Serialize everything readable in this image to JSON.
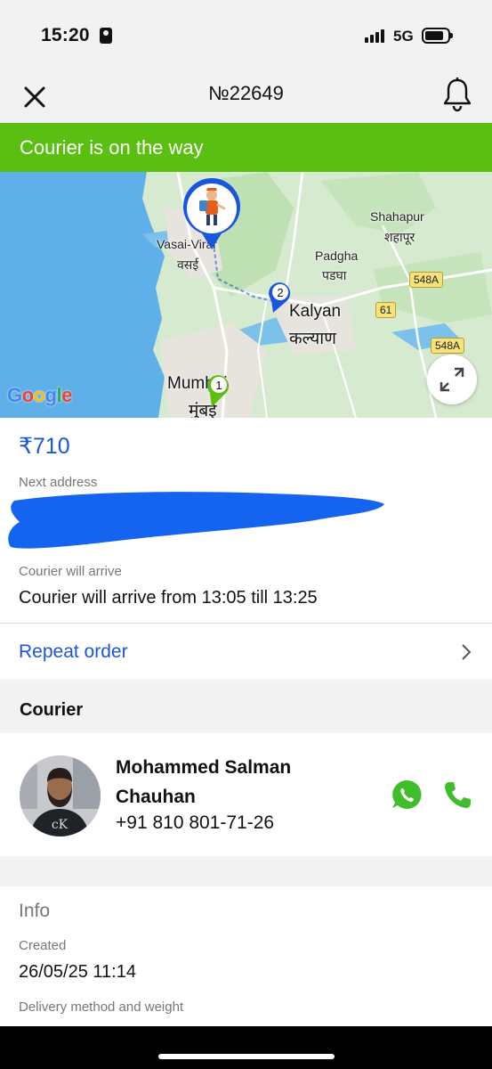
{
  "status_bar": {
    "time": "15:20",
    "network": "5G"
  },
  "header": {
    "order_number": "№22649",
    "close_icon": "close-icon",
    "bell_icon": "bell-icon"
  },
  "status_banner": {
    "text": "Courier is on the way",
    "color": "#5bbf12"
  },
  "map": {
    "labels": {
      "vasai_en": "Vasai-Virar",
      "vasai_local": "वसई",
      "shahapur_en": "Shahapur",
      "shahapur_local": "शहापूर",
      "padgha_en": "Padgha",
      "padgha_local": "पडघा",
      "kalyan_en": "Kalyan",
      "kalyan_local": "कल्याण",
      "mumbai_en": "Mumbai",
      "mumbai_local": "मुंबई"
    },
    "road_badges": [
      "548A",
      "61",
      "548A"
    ],
    "markers": [
      {
        "label": "1",
        "color": "#5bbf12"
      },
      {
        "label": "2",
        "color": "#1a56db"
      }
    ],
    "courier_pin_icon": "courier-pin-icon",
    "provider_logo": "Google",
    "expand_icon": "expand-icon"
  },
  "order": {
    "price": "₹710",
    "next_address_label": "Next address",
    "next_address_value": "",
    "arrival_label": "Courier will arrive",
    "arrival_value": "Courier will arrive from 13:05 till 13:25"
  },
  "repeat_order": {
    "label": "Repeat order",
    "chevron_icon": "chevron-right-icon"
  },
  "courier_section": {
    "title": "Courier",
    "name": "Mohammed Salman Chauhan",
    "phone": "+91 810 801-71-26",
    "whatsapp_icon": "whatsapp-icon",
    "call_icon": "phone-icon"
  },
  "info_section": {
    "title": "Info",
    "created_label": "Created",
    "created_value": "26/05/25 11:14",
    "delivery_label": "Delivery method and weight"
  },
  "colors": {
    "accent_blue": "#1a56db",
    "accent_green": "#5bbf12",
    "background_gray": "#f2f2f2"
  }
}
